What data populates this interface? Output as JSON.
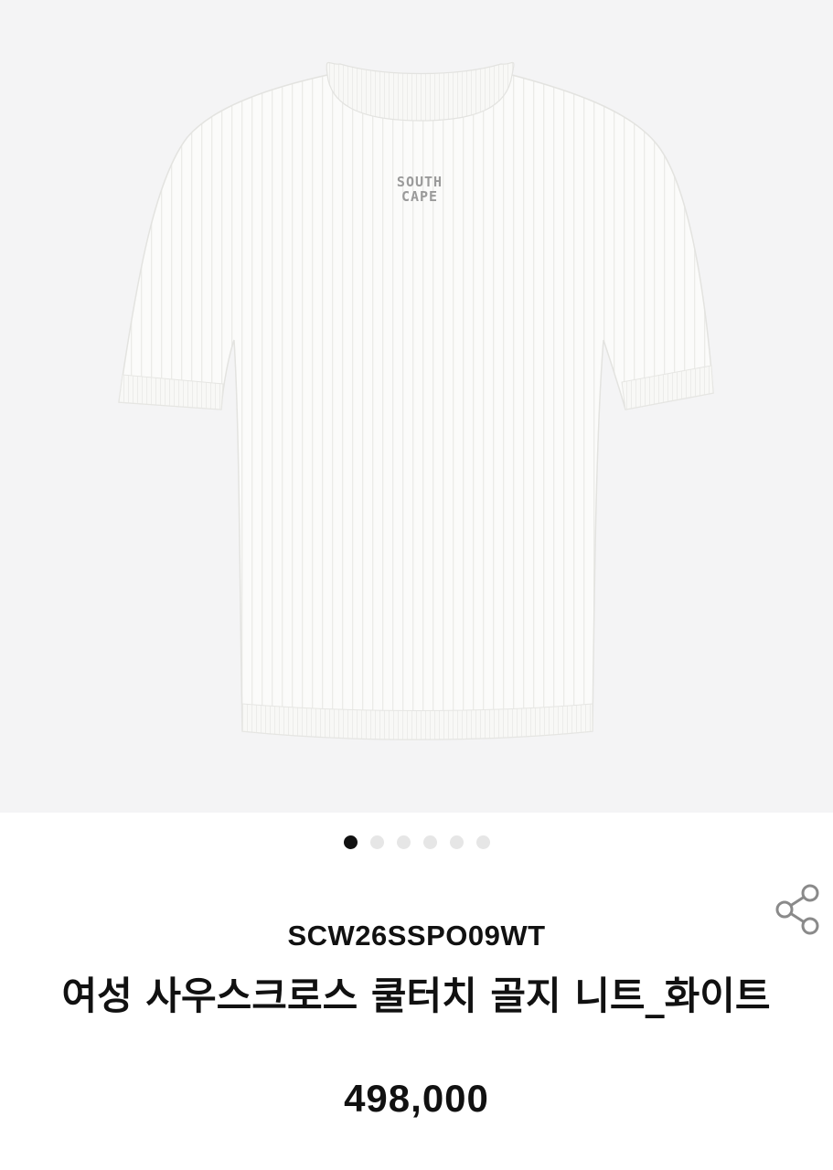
{
  "product_image": {
    "subject": "knit-tshirt",
    "logo_line1": "SOUTH",
    "logo_line2": "CAPE",
    "colors": {
      "background": "#f4f4f5",
      "garment": "#fbfbfa",
      "logo": "#9a9a9a"
    }
  },
  "carousel": {
    "total": 6,
    "active_index": 0
  },
  "share": {
    "icon": "share-icon"
  },
  "product": {
    "code": "SCW26SSPO09WT",
    "name": "여성 사우스크로스 쿨터치 골지 니트_화이트",
    "price": "498,000"
  }
}
